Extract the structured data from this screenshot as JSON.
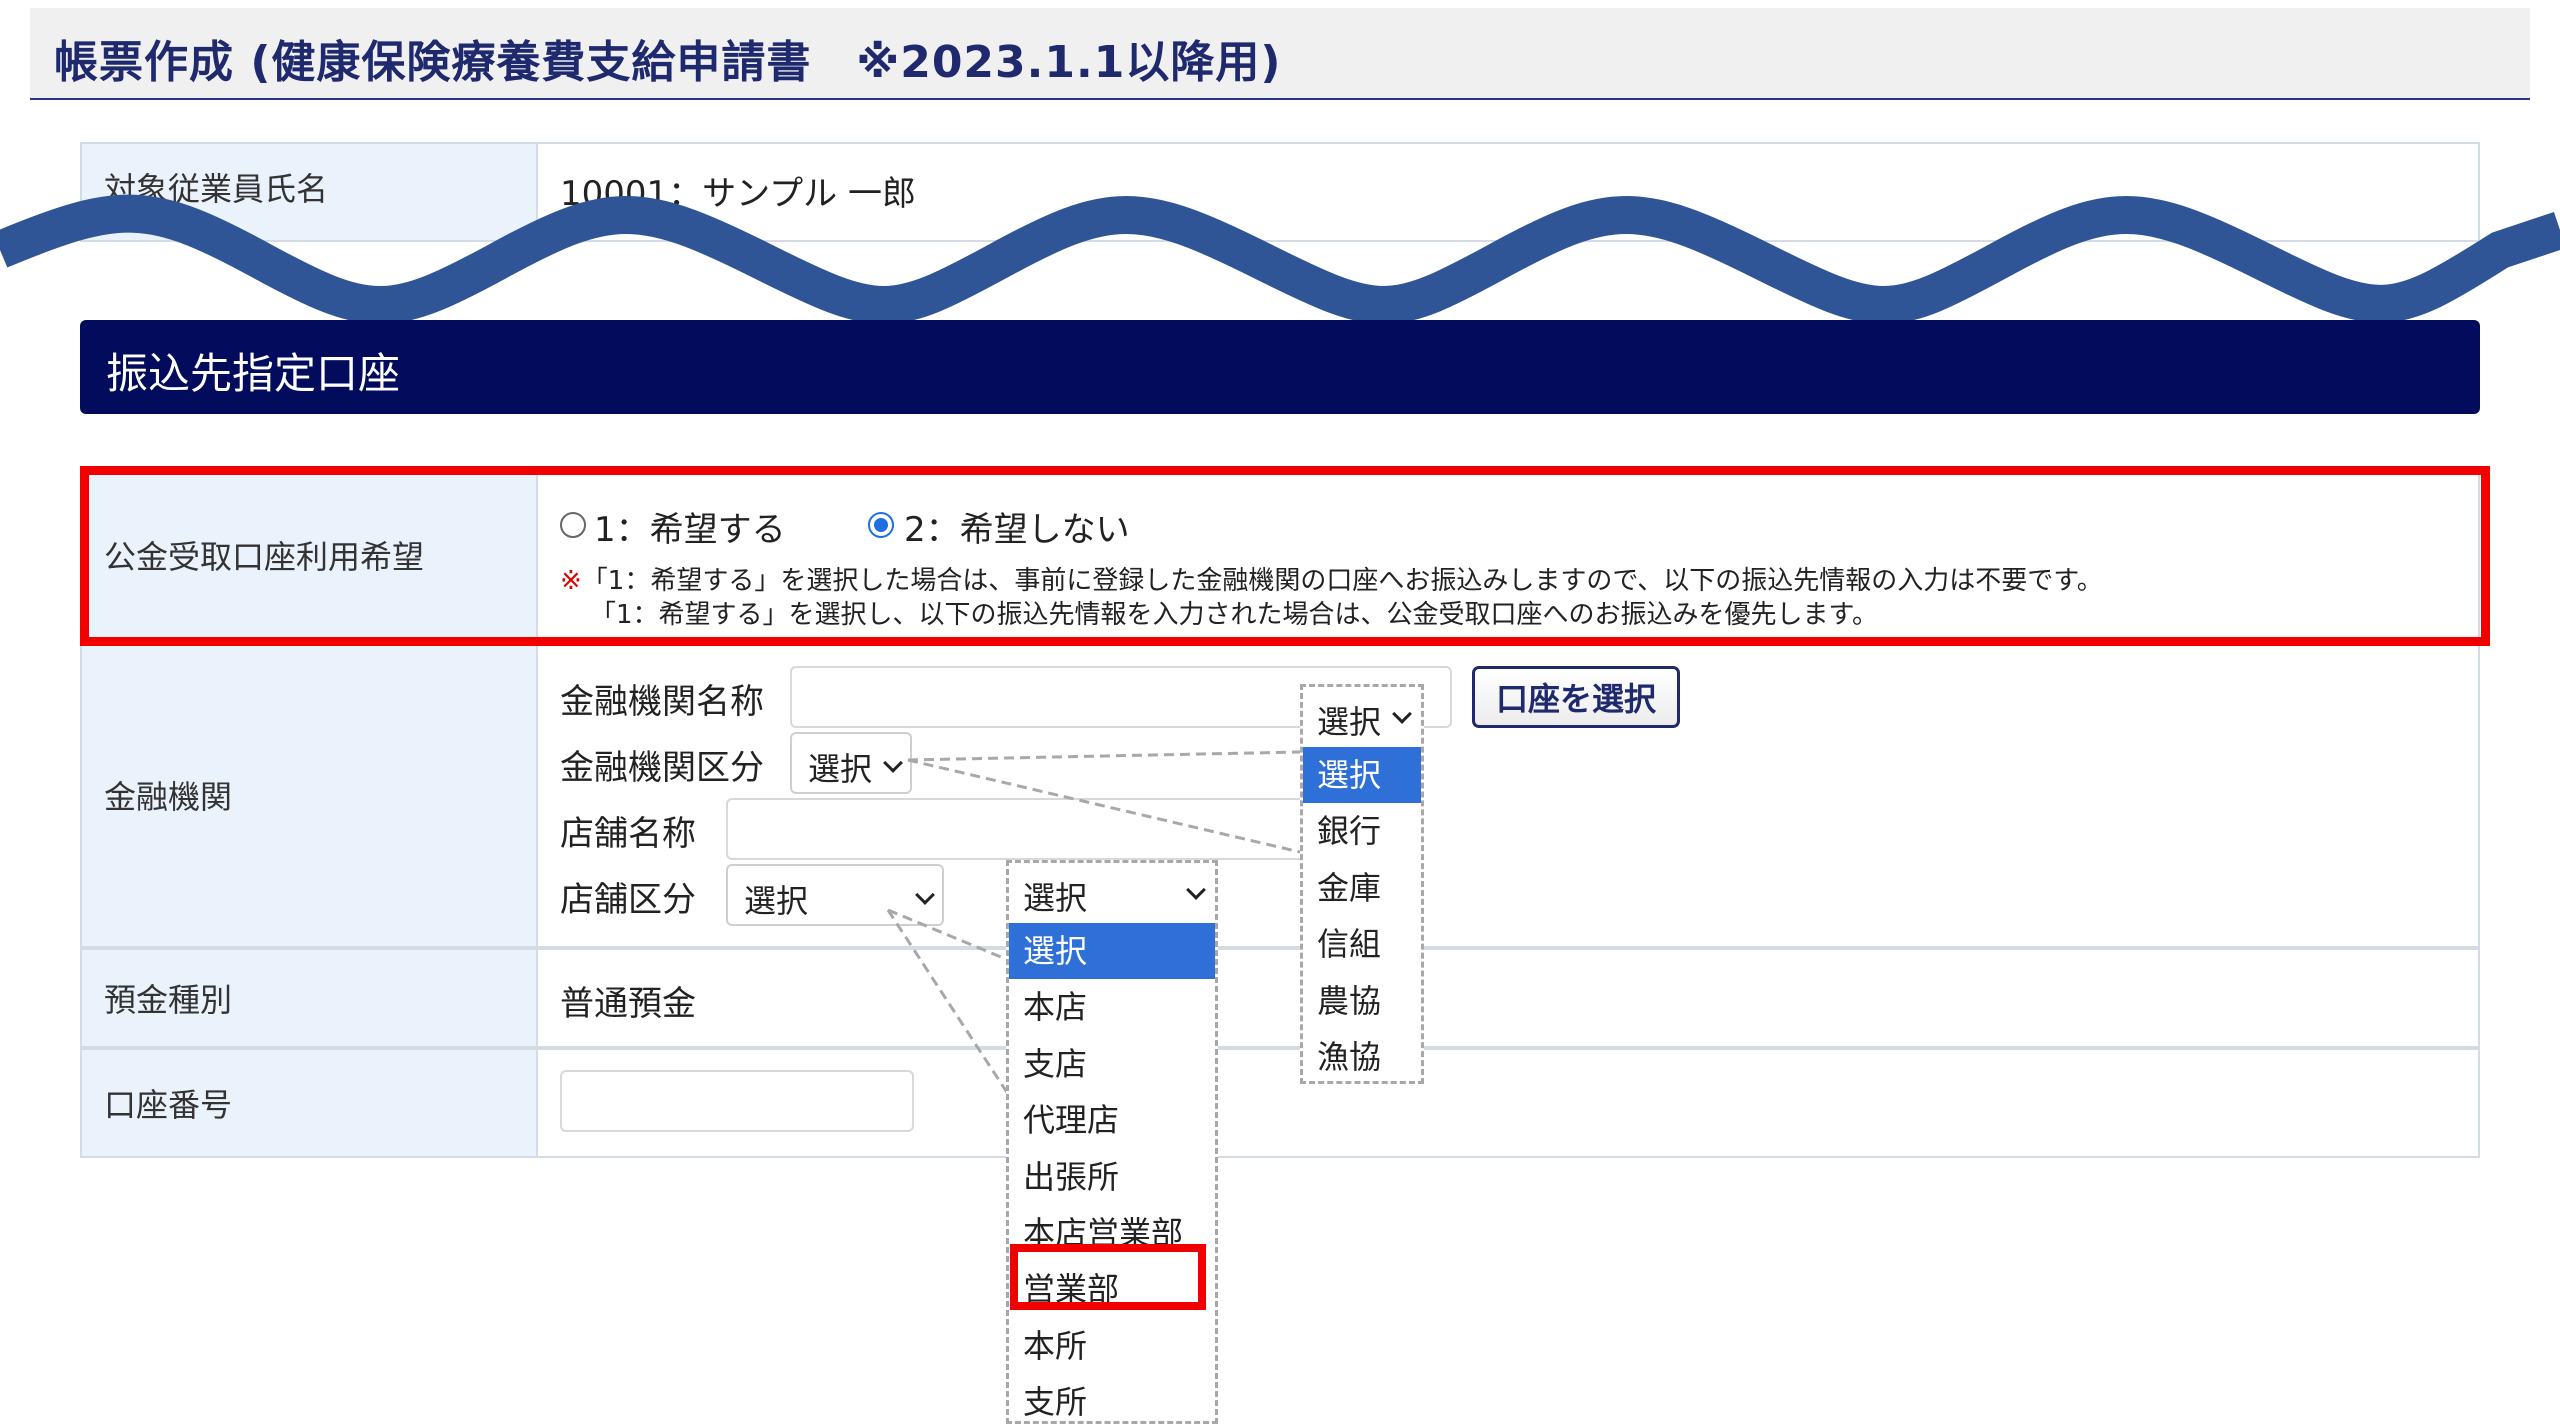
{
  "page": {
    "title": "帳票作成 (健康保険療養費支給申請書　※2023.1.1以降用)"
  },
  "employee": {
    "label": "対象従業員氏名",
    "value": "10001：サンプル 一郎"
  },
  "section": {
    "title": "振込先指定口座"
  },
  "public_account": {
    "label": "公金受取口座利用希望",
    "options": [
      "1：希望する",
      "2：希望しない"
    ],
    "selected_index": 1,
    "note_mark": "※",
    "note_line1": "「1：希望する」を選択した場合は、事前に登録した金融機関の口座へお振込みしますので、以下の振込先情報の入力は不要です。",
    "note_line2": "「1：希望する」を選択し、以下の振込先情報を入力された場合は、公金受取口座へのお振込みを優先します。"
  },
  "bank": {
    "label": "金融機関",
    "name_label": "金融機関名称",
    "name_value": "",
    "select_account_button": "口座を選択",
    "type_label": "金融機関区分",
    "type_value": "選択",
    "branch_label": "店舗名称",
    "branch_value": "",
    "branch_type_label": "店舗区分",
    "branch_type_value": "選択"
  },
  "bank_type_dropdown": {
    "selected": "選択",
    "options": [
      "選択",
      "銀行",
      "金庫",
      "信組",
      "農協",
      "漁協"
    ],
    "active_index": 0
  },
  "branch_type_dropdown": {
    "selected": "選択",
    "options": [
      "選択",
      "本店",
      "支店",
      "代理店",
      "出張所",
      "本店営業部",
      "営業部",
      "本所",
      "支所"
    ],
    "active_index": 0,
    "highlighted_index": 6
  },
  "deposit": {
    "label": "預金種別",
    "value": "普通預金"
  },
  "account_number": {
    "label": "口座番号",
    "value": ""
  },
  "colors": {
    "title": "#1f2a6e",
    "section_bar": "#030b5c",
    "label_bg": "#eaf2fb",
    "wave": "#2f5597",
    "highlight_red": "#f20000",
    "dropdown_active": "#2f6fd8"
  }
}
